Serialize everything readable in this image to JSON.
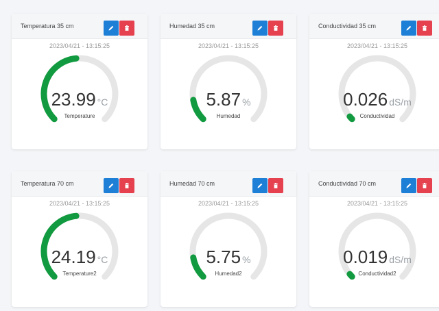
{
  "cards": [
    {
      "title": "Temperatura 35 cm",
      "timestamp": "2023/04/21 - 13:15:25",
      "value": "23.99",
      "unit": "°C",
      "label": "Temperature",
      "fill": 0.48
    },
    {
      "title": "Humedad 35 cm",
      "timestamp": "2023/04/21 - 13:15:25",
      "value": "5.87",
      "unit": "%",
      "label": "Humedad",
      "fill": 0.13
    },
    {
      "title": "Conductividad 35 cm",
      "timestamp": "2023/04/21 - 13:15:25",
      "value": "0.026",
      "unit": "dS/m",
      "label": "Conductividad",
      "fill": 0.02
    },
    {
      "title": "Temperatura 70 cm",
      "timestamp": "2023/04/21 - 13:15:25",
      "value": "24.19",
      "unit": "°C",
      "label": "Temperature2",
      "fill": 0.48
    },
    {
      "title": "Humedad 70 cm",
      "timestamp": "2023/04/21 - 13:15:25",
      "value": "5.75",
      "unit": "%",
      "label": "Humedad2",
      "fill": 0.13
    },
    {
      "title": "Conductividad 70 cm",
      "timestamp": "2023/04/21 - 13:15:25",
      "value": "0.019",
      "unit": "dS/m",
      "label": "Conductividad2",
      "fill": 0.02
    }
  ],
  "colors": {
    "gauge_fill": "#119a3f",
    "gauge_track": "#e6e6e6",
    "edit_button": "#1e7fd6",
    "delete_button": "#e5414f"
  },
  "icons": {
    "edit": "pencil-icon",
    "delete": "trash-icon"
  }
}
